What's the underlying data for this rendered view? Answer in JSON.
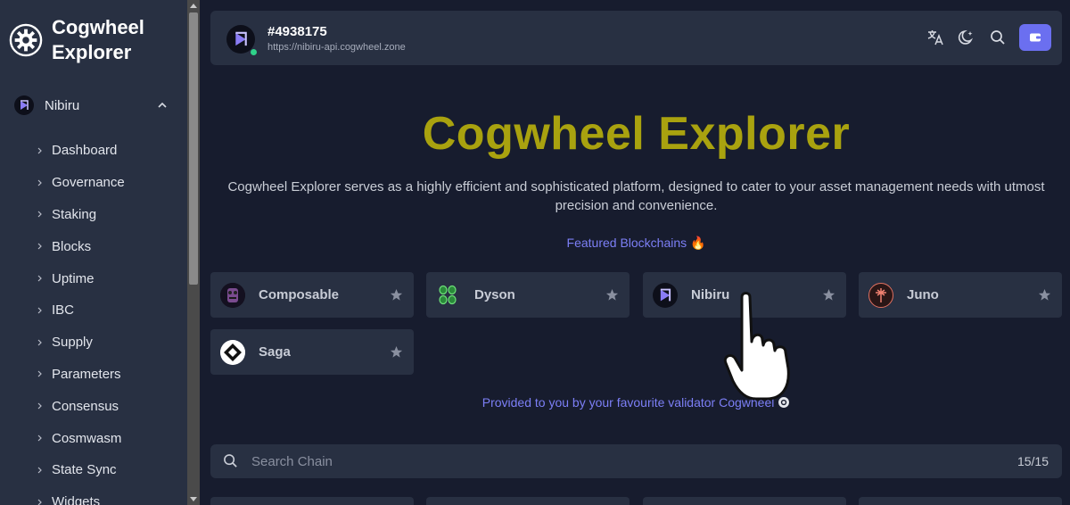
{
  "sidebar": {
    "brand": "Cogwheel Explorer",
    "chain": {
      "name": "Nibiru"
    },
    "items": [
      {
        "label": "Dashboard"
      },
      {
        "label": "Governance"
      },
      {
        "label": "Staking"
      },
      {
        "label": "Blocks"
      },
      {
        "label": "Uptime"
      },
      {
        "label": "IBC"
      },
      {
        "label": "Supply"
      },
      {
        "label": "Parameters"
      },
      {
        "label": "Consensus"
      },
      {
        "label": "Cosmwasm"
      },
      {
        "label": "State Sync"
      },
      {
        "label": "Widgets"
      }
    ]
  },
  "header": {
    "block_height": "#4938175",
    "endpoint": "https://nibiru-api.cogwheel.zone",
    "icons": [
      "translate-icon",
      "theme-moon-icon",
      "search-icon",
      "wallet-icon"
    ]
  },
  "main": {
    "title": "Cogwheel Explorer",
    "description": "Cogwheel Explorer serves as a highly efficient and sophisticated platform, designed to cater to your asset management needs with utmost precision and convenience.",
    "featured_label": "Featured Blockchains 🔥",
    "featured_chains": [
      {
        "name": "Composable",
        "icon": "composable-logo"
      },
      {
        "name": "Dyson",
        "icon": "dyson-logo"
      },
      {
        "name": "Nibiru",
        "icon": "nibiru-logo"
      },
      {
        "name": "Juno",
        "icon": "juno-logo"
      },
      {
        "name": "Saga",
        "icon": "saga-logo"
      }
    ],
    "provided_by": "Provided to you by your favourite validator Cogwheel",
    "search": {
      "placeholder": "Search Chain",
      "count": "15/15"
    }
  },
  "colors": {
    "accent": "#6b6ff0",
    "title": "#a9a20f",
    "status_online": "#2fd28a"
  }
}
